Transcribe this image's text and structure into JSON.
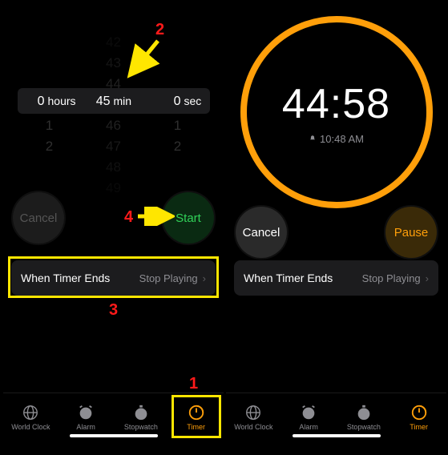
{
  "left": {
    "picker": {
      "hours_sel": "0",
      "hours_unit": "hours",
      "min_sel": "45",
      "min_unit": "min",
      "sec_sel": "0",
      "sec_unit": "sec",
      "min_above": [
        "42",
        "43",
        "44"
      ],
      "min_below": [
        "46",
        "47",
        "48",
        "49"
      ],
      "hours_below": [
        "1",
        "2"
      ],
      "sec_below": [
        "1",
        "2"
      ]
    },
    "cancel": "Cancel",
    "start": "Start",
    "ends_label": "When Timer Ends",
    "ends_value": "Stop Playing"
  },
  "right": {
    "remaining": "44:58",
    "eta": "10:48 AM",
    "cancel": "Cancel",
    "pause": "Pause",
    "ends_label": "When Timer Ends",
    "ends_value": "Stop Playing"
  },
  "tabs": {
    "worldclock": "World Clock",
    "alarm": "Alarm",
    "stopwatch": "Stopwatch",
    "timer": "Timer"
  },
  "anno": {
    "n1": "1",
    "n2": "2",
    "n3": "3",
    "n4": "4"
  }
}
